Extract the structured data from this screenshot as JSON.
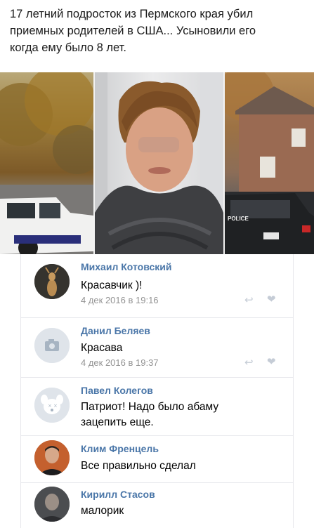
{
  "post": {
    "text": "17 летний подросток из Пермского края убил\nприемных родителей в США... Усыновили его\nкогда ему было 8 лет."
  },
  "photos": {
    "truck_label": "POLICE"
  },
  "comments": [
    {
      "author": "Михаил Котовский",
      "text": "Красавчик )!",
      "date": "4 дек 2016 в 19:16",
      "avatar": "deer-avatar"
    },
    {
      "author": "Данил Беляев",
      "text": "Красава",
      "date": "4 дек 2016 в 19:37",
      "avatar": "camera-placeholder"
    },
    {
      "author": "Павел Колегов",
      "text": "Патриот! Надо было абаму\nзацепить еще.",
      "avatar": "dog-placeholder"
    },
    {
      "author": "Клим Френцель",
      "text": "Все правильно сделал",
      "avatar": "man-photo"
    },
    {
      "author": "Кирилл Стасов",
      "text": "малорик",
      "avatar": "man-photo-dark"
    }
  ],
  "colors": {
    "link": "#4a76a8",
    "meta": "#939393",
    "border": "#e7e8ec"
  }
}
